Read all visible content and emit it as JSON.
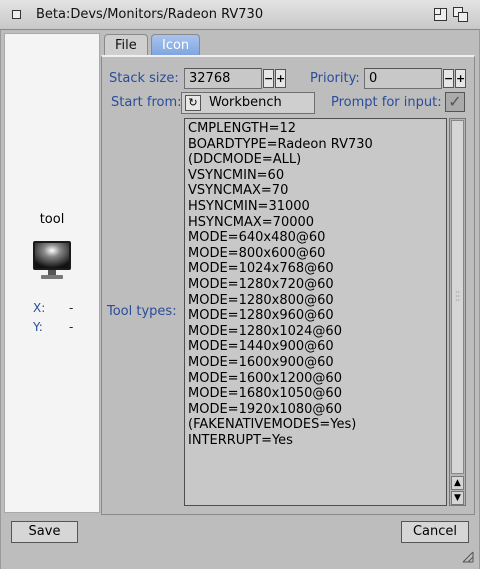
{
  "window": {
    "title": "Beta:Devs/Monitors/Radeon RV730"
  },
  "left_panel": {
    "icon_name": "tool",
    "icon": "monitor-icon",
    "x_label": "X:",
    "x_value": "-",
    "y_label": "Y:",
    "y_value": "-"
  },
  "tabs": [
    {
      "label": "File",
      "active": false
    },
    {
      "label": "Icon",
      "active": true
    }
  ],
  "stack": {
    "label": "Stack size:",
    "value": "32768"
  },
  "priority": {
    "label": "Priority:",
    "value": "0"
  },
  "start_from": {
    "label": "Start from:",
    "value": "Workbench"
  },
  "prompt": {
    "label": "Prompt for input:",
    "checked": true
  },
  "tool_types": {
    "label": "Tool types:",
    "lines": [
      "CMPLENGTH=12",
      "BOARDTYPE=Radeon RV730",
      "(DDCMODE=ALL)",
      "VSYNCMIN=60",
      "VSYNCMAX=70",
      "HSYNCMIN=31000",
      "HSYNCMAX=70000",
      "MODE=640x480@60",
      "MODE=800x600@60",
      "MODE=1024x768@60",
      "MODE=1280x720@60",
      "MODE=1280x800@60",
      "MODE=1280x960@60",
      "MODE=1280x1024@60",
      "MODE=1440x900@60",
      "MODE=1600x900@60",
      "MODE=1600x1200@60",
      "MODE=1680x1050@60",
      "MODE=1920x1080@60",
      "(FAKENATIVEMODES=Yes)",
      "INTERRUPT=Yes"
    ]
  },
  "buttons": {
    "save": "Save",
    "cancel": "Cancel"
  },
  "colors": {
    "label": "#2b4c9a",
    "active_tab": "#7ea4de"
  }
}
